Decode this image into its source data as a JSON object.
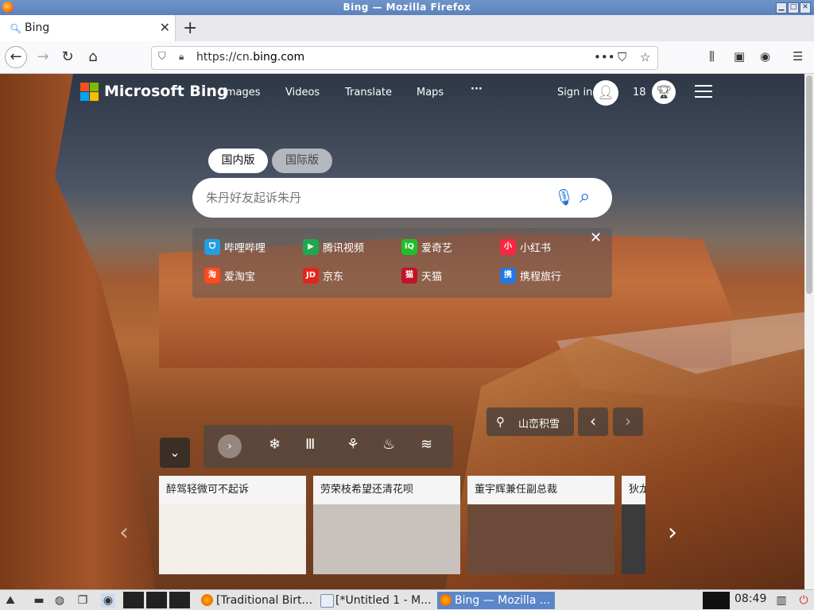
{
  "window": {
    "title": "Bing — Mozilla Firefox"
  },
  "tab": {
    "favicon": "bing-search-icon",
    "label": "Bing"
  },
  "address": {
    "prefix": "https://cn.",
    "domain": "bing.com"
  },
  "header": {
    "brand": "Microsoft Bing",
    "nav": [
      "Images",
      "Videos",
      "Translate",
      "Maps",
      "···"
    ],
    "signin": "Sign in",
    "points": "18"
  },
  "versions": {
    "domestic": "国内版",
    "international": "国际版"
  },
  "search": {
    "placeholder": "朱丹好友起诉朱丹"
  },
  "quicklinks": [
    {
      "label": "哔哩哔哩",
      "color": "#20a0e0",
      "glyph": "ᗜ"
    },
    {
      "label": "腾讯视频",
      "color": "#1fa84f",
      "glyph": "▶"
    },
    {
      "label": "爱奇艺",
      "color": "#1fbf2a",
      "glyph": "iQ"
    },
    {
      "label": "小红书",
      "color": "#ff2442",
      "glyph": "小"
    },
    {
      "label": "爱淘宝",
      "color": "#ff4a1f",
      "glyph": "淘"
    },
    {
      "label": "京东",
      "color": "#e1251b",
      "glyph": "JD"
    },
    {
      "label": "天猫",
      "color": "#c3112a",
      "glyph": "猫"
    },
    {
      "label": "携程旅行",
      "color": "#2577e3",
      "glyph": "携"
    }
  ],
  "location": {
    "label": "山峦积雪"
  },
  "news": [
    {
      "title": "醉驾轻微可不起诉",
      "bg": "#f2efe8"
    },
    {
      "title": "劳荣枝希望还清花呗",
      "bg": "#c9c2bc"
    },
    {
      "title": "董宇辉兼任副总裁",
      "bg": "#6b4a3a"
    },
    {
      "title": "狄龙",
      "bg": "#3b3b3b"
    }
  ],
  "taskbar": {
    "tasks": [
      "[Traditional Birt...",
      "[*Untitled 1 - M...",
      "Bing — Mozilla ..."
    ],
    "clock": "08:49"
  },
  "colors": {
    "accent": "#1a6fd6",
    "titlebar": "#5b82bb",
    "taskbar_active": "#5b86c8"
  }
}
